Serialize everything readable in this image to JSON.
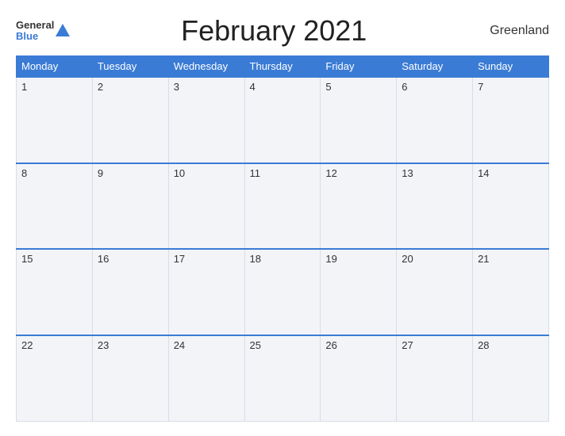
{
  "header": {
    "logo": {
      "general": "General",
      "blue": "Blue",
      "triangle": true
    },
    "title": "February 2021",
    "region": "Greenland"
  },
  "calendar": {
    "days_of_week": [
      "Monday",
      "Tuesday",
      "Wednesday",
      "Thursday",
      "Friday",
      "Saturday",
      "Sunday"
    ],
    "weeks": [
      [
        "1",
        "2",
        "3",
        "4",
        "5",
        "6",
        "7"
      ],
      [
        "8",
        "9",
        "10",
        "11",
        "12",
        "13",
        "14"
      ],
      [
        "15",
        "16",
        "17",
        "18",
        "19",
        "20",
        "21"
      ],
      [
        "22",
        "23",
        "24",
        "25",
        "26",
        "27",
        "28"
      ]
    ]
  }
}
